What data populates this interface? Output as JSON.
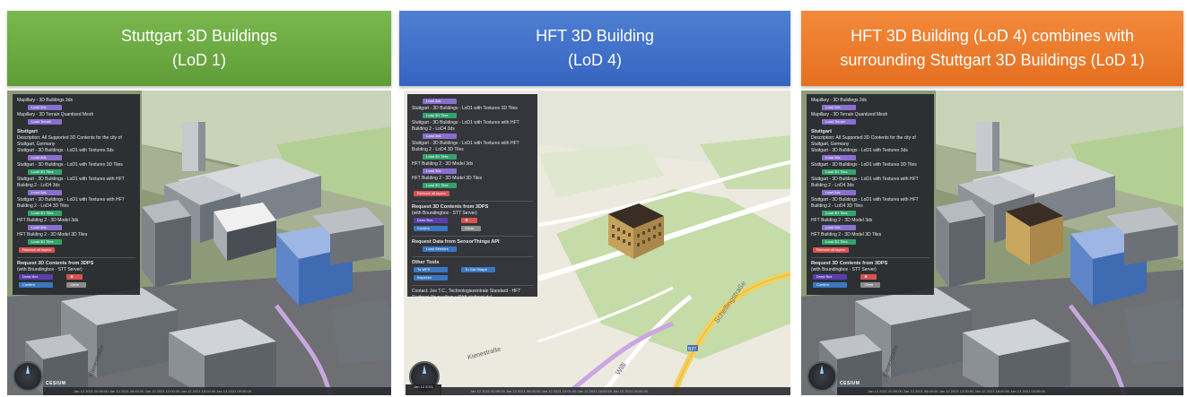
{
  "banners": [
    {
      "line1": "Stuttgart 3D Buildings",
      "line2": "(LoD 1)",
      "color": "#6aaa40"
    },
    {
      "line1": "HFT 3D Building",
      "line2": "(LoD 4)",
      "color": "#3e6fc8"
    },
    {
      "line1": "HFT 3D Building (LoD 4) combines with",
      "line2": "surrounding Stuttgart 3D Buildings (LoD 1)",
      "color": "#ec7a2c"
    }
  ],
  "panel_lod1": {
    "lines": [
      "Mapillary - 3D Buildings 3ds",
      "Mapillary - 3D Terrain Quantized Mesh"
    ],
    "load_btn1": "Load 3ds",
    "load_btn2": "Load Terrain",
    "section_title": "Stuttgart",
    "description": "Description: All Supported 3D Contents for the city of Stuttgart, Germany",
    "items": [
      "Stuttgart - 3D Buildings - LoD1 with Textures 3ds",
      "Stuttgart - 3D Buildings - LoD1 with Textures 3D Tiles",
      "Stuttgart - 3D Buildings - LoD1 with Textures with HFT Building 2 - LoD4 3ds",
      "Stuttgart - 3D Buildings - LoD1 with Textures with HFT Building 2 - LoD4 3D Tiles",
      "HFT Building 2 - 3D Model 3ds",
      "HFT Building 2 - 3D Model 3D Tiles"
    ],
    "remove_btn": "Remove all layers",
    "request_title": "Request 3D Contents from 3DPS",
    "request_sub": "(with Boundingbox - STT Server)",
    "draw_btn": "Draw Box",
    "confirm_btn": "Confirm",
    "clear_btn": "Clear"
  },
  "panel_lod4": {
    "items": [
      "Stuttgart - 3D Buildings - LoD1 with Textures 3D Tiles",
      "Stuttgart - 3D Buildings - LoD1 with Textures with HFT Building 2 - LoD4 3ds",
      "Stuttgart - 3D Buildings - LoD1 with Textures with HFT Building 2 - LoD4 3D Tiles",
      "HFT Building 2 - 3D Model 3ds",
      "HFT Building 2 - 3D Model 3D Tiles"
    ],
    "remove_btn": "Remove all layers",
    "request_title": "Request 3D Contents from 3DPS",
    "request_sub": "(with Boundingbox - STT Server)",
    "draw_btn": "Draw Box",
    "confirm_btn": "Confirm",
    "clear_btn": "Clear",
    "sensor_title": "Request Data from SensorThings API",
    "sensor_btn": "Load Sensors",
    "tools_title": "Other Tools",
    "tool_btn1": "To WFS",
    "tool_btn2": "To Get Shape",
    "tool_btn3": "Inspector",
    "contact": "Contact: Joe T.C., Technologiezentrale Standard - HFT Stuttgart (thunyathep.s@hft-stuttgart.de)"
  },
  "bottom": {
    "date": "Jan 12 2021",
    "time": "10:18:11 UTC",
    "brand": "CESIUM",
    "timeline_text": "Jan 12 2021 00:00:00   Jan 12 2021 06:00:00   Jan 12 2021 12:00:00   Jan 12 2021 18:00:00   Jan 13 2021 00:00:00"
  },
  "map_labels": {
    "street1": "Kienestraße",
    "street2": "Willi",
    "street3": "Schellingstraße",
    "route": "B27",
    "v3_street": "Kienestraße"
  }
}
